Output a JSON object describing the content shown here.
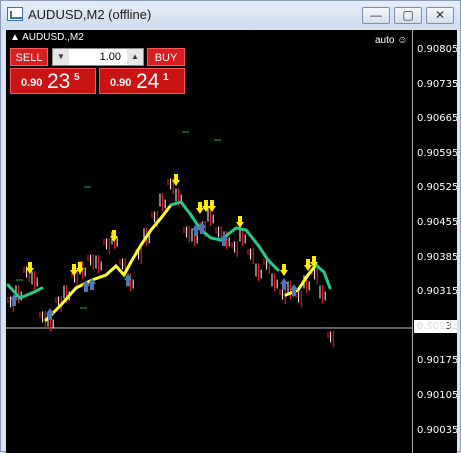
{
  "window": {
    "title": "AUDUSD,M2 (offline)",
    "minimize": "—",
    "restore": "▢",
    "close": "✕"
  },
  "chart": {
    "symbol_label": "AUDUSD.,M2",
    "auto_label": "auto",
    "current_price": "0.90235",
    "price_ticks": [
      "0.90805",
      "0.90735",
      "0.90665",
      "0.90595",
      "0.90525",
      "0.90455",
      "0.90385",
      "0.90315",
      "0.90245",
      "0.90175",
      "0.90105",
      "0.90035"
    ]
  },
  "trade_panel": {
    "sell_label": "SELL",
    "buy_label": "BUY",
    "lot": "1.00",
    "sell_price": {
      "prefix": "0.90",
      "big": "23",
      "sup": "5"
    },
    "buy_price": {
      "prefix": "0.90",
      "big": "24",
      "sup": "1"
    }
  },
  "colors": {
    "bg": "#000000",
    "candle_up": "#ffffff",
    "candle_down": "#ff2020",
    "ma_up": "#ffff33",
    "ma_down": "#22cc88",
    "arrow_up": "#4a78b8",
    "arrow_down": "#ffee00",
    "panel_red": "#c91414"
  }
}
